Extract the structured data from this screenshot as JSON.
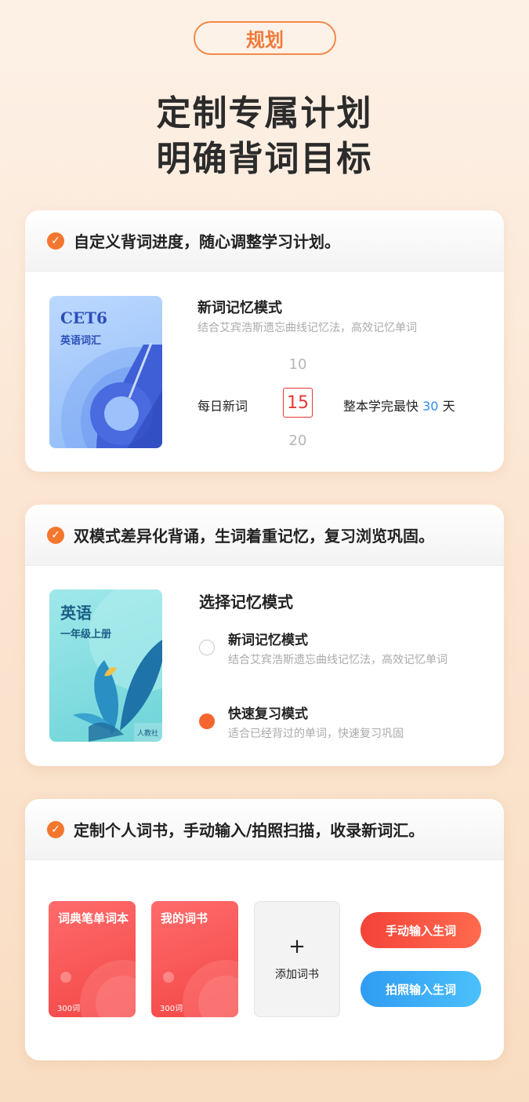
{
  "tag": "规划",
  "headline": {
    "line1": "定制专属计划",
    "line2": "明确背词目标"
  },
  "card1": {
    "header": "自定义背词进度，随心调整学习计划。",
    "book": {
      "title": "CET6",
      "subtitle": "英语词汇",
      "big_number": "6"
    },
    "mode_title": "新词记忆模式",
    "mode_desc": "结合艾宾浩斯遗忘曲线记忆法，高效记忆单词",
    "daily_label": "每日新词",
    "picker": {
      "above": "10",
      "selected": "15",
      "below": "20"
    },
    "finish_prefix": "整本学完最快",
    "finish_days": "30",
    "finish_suffix": "天"
  },
  "card2": {
    "header": "双模式差异化背诵，生词着重记忆，复习浏览巩固。",
    "book": {
      "title": "英语",
      "subtitle": "一年级上册",
      "publisher": "人教社"
    },
    "section_title": "选择记忆模式",
    "options": [
      {
        "title": "新词记忆模式",
        "desc": "结合艾宾浩斯遗忘曲线记忆法，高效记忆单词",
        "selected": false
      },
      {
        "title": "快速复习模式",
        "desc": "适合已经背过的单词，快速复习巩固",
        "selected": true
      }
    ]
  },
  "card3": {
    "header": "定制个人词书，手动输入/拍照扫描，收录新词汇。",
    "books": [
      {
        "title": "词典笔单词本",
        "count": "300词"
      },
      {
        "title": "我的词书",
        "count": "300词"
      }
    ],
    "add_label": "添加词书",
    "add_symbol": "+",
    "manual_button": "手动输入生词",
    "photo_button": "拍照输入生词"
  },
  "colors": {
    "accent_orange": "#f4772f",
    "picker_red": "#e53935",
    "days_blue": "#2f8df0",
    "btn_red": "#f5413c",
    "btn_blue": "#33a6f5"
  }
}
